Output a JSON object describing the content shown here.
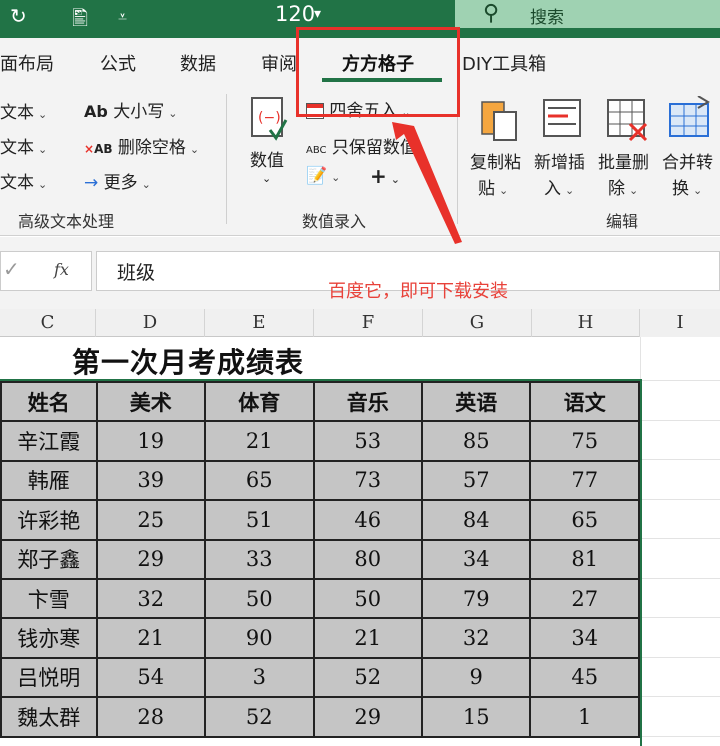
{
  "titlebar": {
    "zoom_value": "120",
    "search_label": "搜索"
  },
  "tabs": {
    "items": [
      "面布局",
      "公式",
      "数据",
      "审阅",
      "方方格子",
      "DIY工具箱"
    ]
  },
  "ribbon": {
    "left_rows": [
      "文本",
      "文本",
      "文本"
    ],
    "case_label": "大小写",
    "remove_space_label": "删除空格",
    "more_label": "更多",
    "group_text": "高级文本处理",
    "value_label": "数值",
    "round_label": "四舍五入",
    "keep_value_label": "只保留数值",
    "group_value": "数值录入",
    "copy_paste_l1": "复制粘",
    "copy_paste_l2": "贴",
    "new_insert_l1": "新增插",
    "new_insert_l2": "入",
    "batch_delete_l1": "批量删",
    "batch_delete_l2": "除",
    "merge_l1": "合并转",
    "merge_l2": "换",
    "group_edit": "编辑",
    "ab_small": "Ab",
    "ab_tiny": "AB",
    "abc_tiny": "ABC",
    "plus": "+"
  },
  "formula_bar": {
    "fx": "fx",
    "value": "班级"
  },
  "annotation": "百度它，即可下载安装",
  "columns": [
    "C",
    "D",
    "E",
    "F",
    "G",
    "H",
    "I"
  ],
  "sheet": {
    "title": "第一次月考成绩表",
    "headers": [
      "姓名",
      "美术",
      "体育",
      "音乐",
      "英语",
      "语文"
    ],
    "rows": [
      [
        "辛江霞",
        "19",
        "21",
        "53",
        "85",
        "75"
      ],
      [
        "韩雁",
        "39",
        "65",
        "73",
        "57",
        "77"
      ],
      [
        "许彩艳",
        "25",
        "51",
        "46",
        "84",
        "65"
      ],
      [
        "郑子鑫",
        "29",
        "33",
        "80",
        "34",
        "81"
      ],
      [
        "卞雪",
        "32",
        "50",
        "50",
        "79",
        "27"
      ],
      [
        "钱亦寒",
        "21",
        "90",
        "21",
        "32",
        "34"
      ],
      [
        "吕悦明",
        "54",
        "3",
        "52",
        "9",
        "45"
      ],
      [
        "魏太群",
        "28",
        "52",
        "29",
        "15",
        "1"
      ]
    ]
  },
  "colors": {
    "excel_green": "#217346",
    "highlight_red": "#e8312a",
    "cell_gray": "#c5c5c5"
  }
}
